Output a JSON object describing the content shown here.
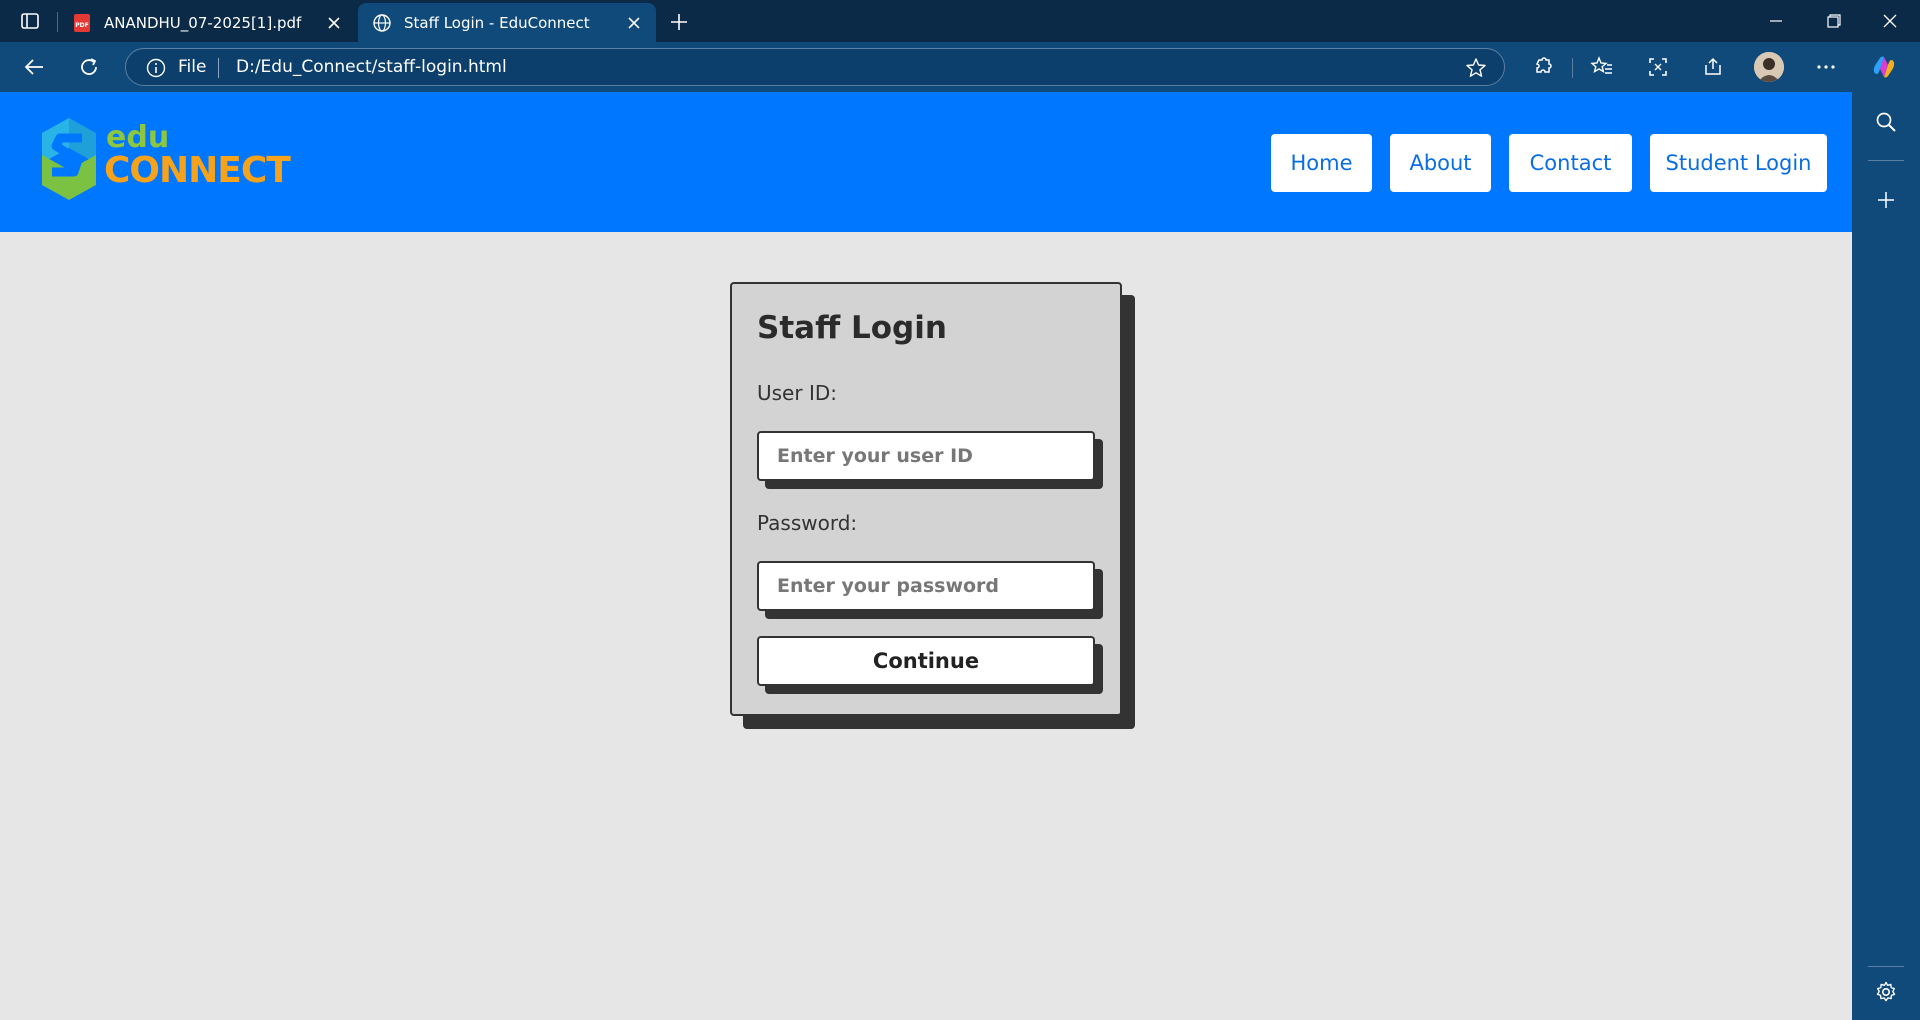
{
  "browser": {
    "tabs": [
      {
        "title": "ANANDHU_07-2025[1].pdf",
        "favicon": "pdf-icon",
        "active": false
      },
      {
        "title": "Staff Login - EduConnect",
        "favicon": "globe-icon",
        "active": true
      }
    ],
    "address": {
      "scheme_label": "File",
      "url": "D:/Edu_Connect/staff-login.html"
    }
  },
  "site": {
    "logo": {
      "line1": "edu",
      "line2": "CONNECT"
    },
    "nav": [
      "Home",
      "About",
      "Contact",
      "Student Login"
    ]
  },
  "login": {
    "title": "Staff Login",
    "user_label": "User ID:",
    "user_placeholder": "Enter your user ID",
    "password_label": "Password:",
    "password_placeholder": "Enter your password",
    "submit_label": "Continue"
  },
  "colors": {
    "header_bg": "#0077ff",
    "page_bg": "#e6e6e6",
    "card_bg": "#d3d3d3",
    "card_shadow": "#333333",
    "logo_green": "#8dc63f",
    "logo_orange": "#f7a21b",
    "browser_frame": "#0f4a7a"
  }
}
